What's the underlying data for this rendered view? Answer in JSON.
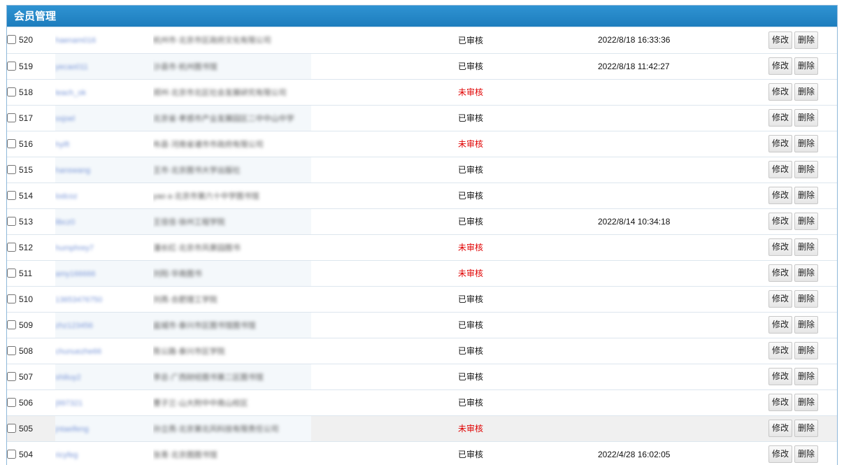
{
  "panel": {
    "title": "会员管理",
    "edit_label": "修改",
    "delete_label": "删除"
  },
  "colors": {
    "title_bar": "#1f86c8",
    "unreviewed": "#e00000",
    "link": "#7c98d8"
  },
  "rows": [
    {
      "id": "520",
      "username": "haenam016",
      "unit": "杭州市·北京市区政府文化有限公司",
      "status": "已审核",
      "reviewed": true,
      "time": "2022/8/18 16:33:36"
    },
    {
      "id": "519",
      "username": "yecao011",
      "unit": "沙县市·杭州图书馆",
      "status": "已审核",
      "reviewed": true,
      "time": "2022/8/18 11:42:27"
    },
    {
      "id": "518",
      "username": "leach_ok",
      "unit": "郑州·北京市北区社会发展研究有限公司",
      "status": "未审核",
      "reviewed": false,
      "time": ""
    },
    {
      "id": "517",
      "username": "ssjoel",
      "unit": "北京省·孝感市产业发展园区二中中山中学",
      "status": "已审核",
      "reviewed": true,
      "time": ""
    },
    {
      "id": "516",
      "username": "hyift",
      "unit": "布县·河南省诸市市政府有限公司",
      "status": "未审核",
      "reviewed": false,
      "time": ""
    },
    {
      "id": "515",
      "username": "hanswang",
      "unit": "王市·北京图书大学出版社",
      "status": "已审核",
      "reviewed": true,
      "time": ""
    },
    {
      "id": "514",
      "username": "lodcoz",
      "unit": "yao a·北京市第六十中学图书馆",
      "status": "已审核",
      "reviewed": true,
      "time": ""
    },
    {
      "id": "513",
      "username": "libcz0",
      "unit": "王佳佳·徐州工程学院",
      "status": "已审核",
      "reviewed": true,
      "time": "2022/8/14 10:34:18"
    },
    {
      "id": "512",
      "username": "humphrey7",
      "unit": "潘长红·北京市风景园图书",
      "status": "未审核",
      "reviewed": false,
      "time": ""
    },
    {
      "id": "511",
      "username": "amy166666",
      "unit": "刘阳·华南图书",
      "status": "未审核",
      "reviewed": false,
      "time": ""
    },
    {
      "id": "510",
      "username": "13653476750",
      "unit": "刘燕·合肥理工学院",
      "status": "已审核",
      "reviewed": true,
      "time": ""
    },
    {
      "id": "509",
      "username": "zhz123456",
      "unit": "盐城市·泰兴市区图书馆图书馆",
      "status": "已审核",
      "reviewed": true,
      "time": ""
    },
    {
      "id": "508",
      "username": "chunuezhe66",
      "unit": "陈公路·泰兴市区学院",
      "status": "已审核",
      "reviewed": true,
      "time": ""
    },
    {
      "id": "507",
      "username": "shiliuy2",
      "unit": "李总·广西财经图书第二区图书馆",
      "status": "已审核",
      "reviewed": true,
      "time": ""
    },
    {
      "id": "506",
      "username": "j997321",
      "unit": "曹子兰·山大附中中南山校区",
      "status": "已审核",
      "reviewed": true,
      "time": ""
    },
    {
      "id": "505",
      "username": "jntaeifeng",
      "unit": "孙立燕·北京第北风科技有限责任公司",
      "status": "未审核",
      "reviewed": false,
      "time": ""
    },
    {
      "id": "504",
      "username": "ricyfeg",
      "unit": "张青·北京图图书馆",
      "status": "已审核",
      "reviewed": true,
      "time": "2022/4/28 16:02:05"
    }
  ]
}
